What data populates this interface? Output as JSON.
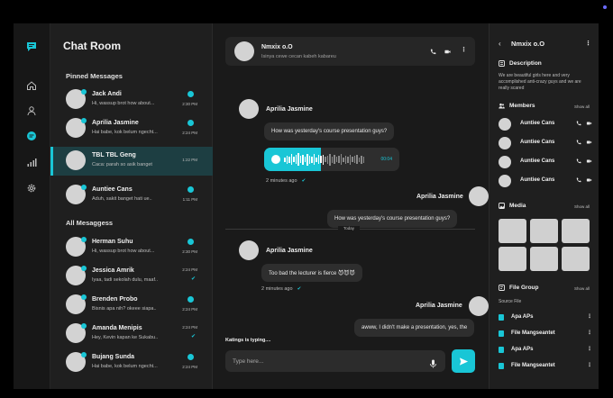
{
  "list": {
    "title": "Chat Room",
    "pinned_label": "Pinned Messages",
    "all_label": "All Mesaggess",
    "pinned": [
      {
        "name": "Jack Andi",
        "preview": "Hi, wassup brot how about...",
        "time": "2:30 PM",
        "status": "badge"
      },
      {
        "name": "Aprilia Jasmine",
        "preview": "Hai babe, kok belum ngecht...",
        "time": "2:24 PM",
        "status": "badge"
      },
      {
        "name": "TBL TBL Geng",
        "preview": "Caca: parah so asik banget",
        "time": "1:22 PM",
        "status": "none"
      },
      {
        "name": "Auntiee Cans",
        "preview": "Aduh, sakit banget hati ue..",
        "time": "1:11 PM",
        "status": "badge"
      }
    ],
    "all": [
      {
        "name": "Herman Suhu",
        "preview": "Hi, wassup brot how about...",
        "time": "2:30 PM",
        "status": "badge"
      },
      {
        "name": "Jessica Amrik",
        "preview": "Iyaa, tadi sekolah dulu, maaf..",
        "time": "2:24 PM",
        "status": "check"
      },
      {
        "name": "Brenden Probo",
        "preview": "Bisnis apa nih? okeee siapa..",
        "time": "2:24 PM",
        "status": "badge"
      },
      {
        "name": "Amanda Menipis",
        "preview": "Hey, Kevin kapan ke Sukabu..",
        "time": "2:24 PM",
        "status": "check"
      },
      {
        "name": "Bujang Sunda",
        "preview": "Hai babe, kok belum ngecht...",
        "time": "2:24 PM",
        "status": "badge"
      }
    ]
  },
  "chat": {
    "header_name": "Nmxix o.O",
    "header_sub": "Isinya cewe cecan kabeh kabareu",
    "messages": {
      "m1_name": "Aprilia Jasmine",
      "m1_text": "How was yesterday's course presentation guys?",
      "voice_duration": "00:04",
      "m1_time": "2 minutes ago",
      "m2_name": "Aprilia Jasmine",
      "m2_text": "How was yesterday's course presentation guys?",
      "m2_time": "2 minutes ago",
      "divider": "Today",
      "m3_name": "Aprilia Jasmine",
      "m3_text": "Too bad the lecturer is fierce 😈😈😈",
      "m3_time": "2 minutes ago",
      "m4_name": "Aprilia Jasmine",
      "m4_text": "awww, I didn't make a presentation, yes, the"
    },
    "voice_progress": 0.42,
    "typing": "Katings is typing....",
    "input_placeholder": "Type here..."
  },
  "details": {
    "name": "Nmxix o.O",
    "description_label": "Description",
    "description_text": "We are beautiful girls here and very accomplished anti-crazy guys and we are really scared",
    "members_label": "Members",
    "show_all": "Show all",
    "members": [
      "Auntiee Cans",
      "Auntiee Cans",
      "Auntiee Cans",
      "Auntiee Cans"
    ],
    "media_label": "Media",
    "file_group_label": "File Group",
    "source_file": "Source File",
    "files": [
      "Apa APs",
      "File Mangseantet",
      "Apa APs",
      "File Mangseantet"
    ]
  },
  "colors": {
    "accent": "#19c6d6",
    "bg": "#1c1c1c",
    "bubble": "#2e2e2e"
  }
}
